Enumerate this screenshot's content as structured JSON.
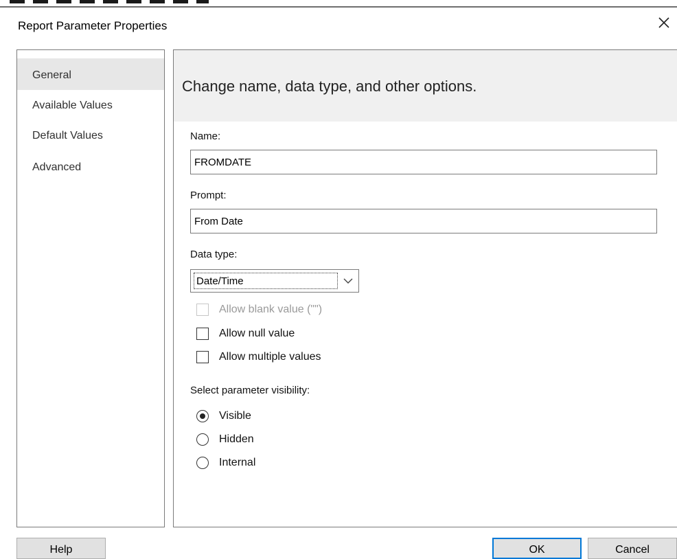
{
  "window": {
    "title": "Report Parameter Properties",
    "close_icon": "close-icon"
  },
  "nav": {
    "items": [
      {
        "label": "General",
        "selected": true
      },
      {
        "label": "Available Values",
        "selected": false
      },
      {
        "label": "Default Values",
        "selected": false
      },
      {
        "label": "Advanced",
        "selected": false
      }
    ]
  },
  "content": {
    "heading": "Change name, data type, and other options.",
    "name": {
      "label": "Name:",
      "value": "FROMDATE"
    },
    "prompt": {
      "label": "Prompt:",
      "value": "From Date"
    },
    "data_type": {
      "label": "Data type:",
      "value": "Date/Time",
      "dropdown_icon": "chevron-down-icon"
    },
    "checkboxes": [
      {
        "label": "Allow blank value (\"\")",
        "checked": false,
        "enabled": false
      },
      {
        "label": "Allow null value",
        "checked": false,
        "enabled": true
      },
      {
        "label": "Allow multiple values",
        "checked": false,
        "enabled": true
      }
    ],
    "visibility": {
      "label": "Select parameter visibility:",
      "options": [
        {
          "label": "Visible",
          "selected": true
        },
        {
          "label": "Hidden",
          "selected": false
        },
        {
          "label": "Internal",
          "selected": false
        }
      ]
    }
  },
  "buttons": {
    "help": "Help",
    "ok": "OK",
    "cancel": "Cancel"
  },
  "colors": {
    "accent": "#0078d7",
    "selected_nav": "#e7e7e7",
    "banner": "#f0f0f0"
  }
}
